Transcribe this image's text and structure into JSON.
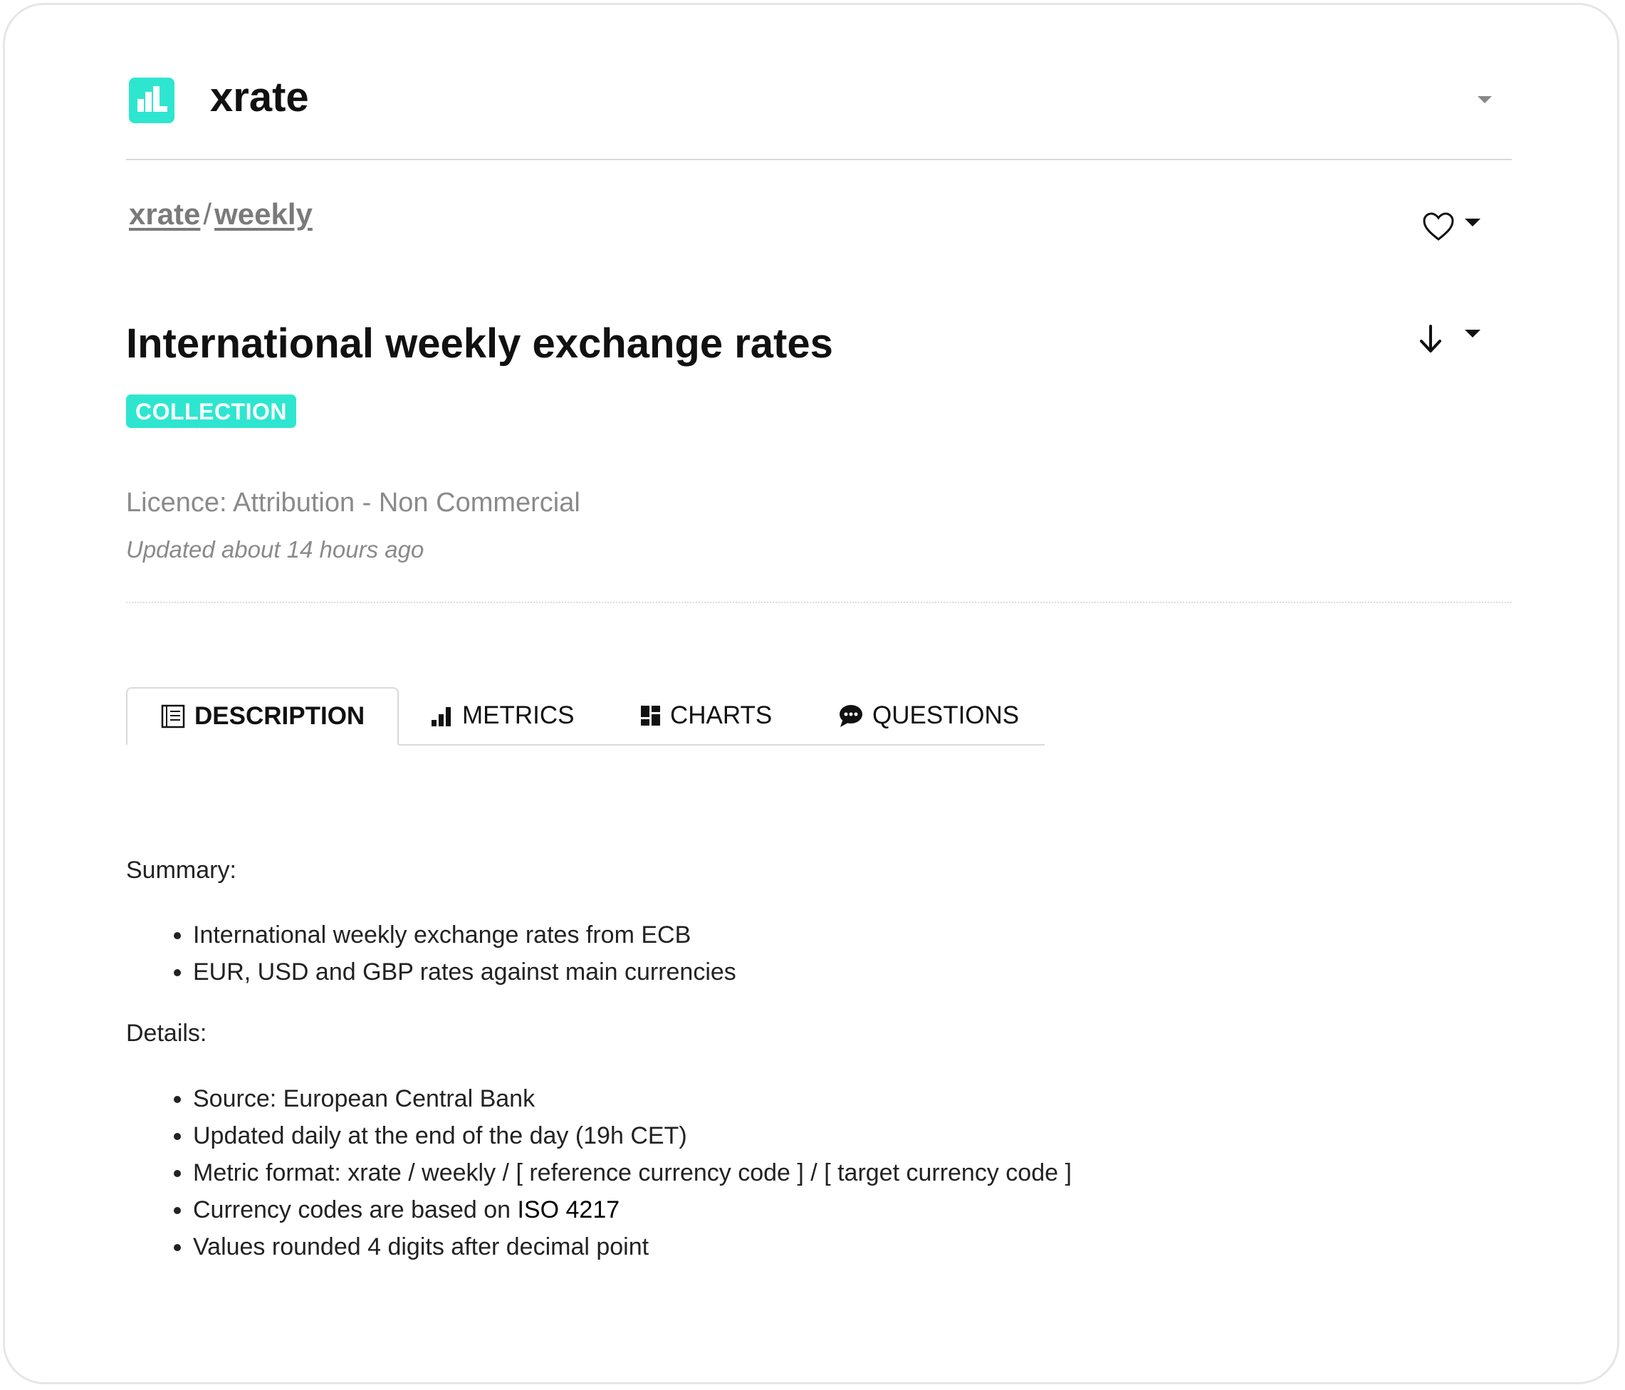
{
  "header": {
    "app_name": "xrate"
  },
  "breadcrumb": {
    "items": [
      "xrate",
      "weekly"
    ],
    "separator": "/"
  },
  "dataset": {
    "title": "International weekly exchange rates",
    "badge": "COLLECTION",
    "licence": "Licence: Attribution - Non Commercial",
    "updated": "Updated about 14 hours ago"
  },
  "tabs": [
    {
      "label": "DESCRIPTION",
      "icon": "document-icon",
      "active": true
    },
    {
      "label": "METRICS",
      "icon": "bar-chart-icon",
      "active": false
    },
    {
      "label": "CHARTS",
      "icon": "dashboard-icon",
      "active": false
    },
    {
      "label": "QUESTIONS",
      "icon": "chat-icon",
      "active": false
    }
  ],
  "description": {
    "summary_heading": "Summary:",
    "summary_items": [
      "International weekly exchange rates from ECB",
      "EUR, USD and GBP rates against main currencies"
    ],
    "details_heading": "Details:",
    "details_items": [
      "Source: European Central Bank",
      "Updated daily at the end of the day (19h CET)",
      "Metric format: xrate / weekly / [ reference currency code ] / [ target currency code ]",
      "Currency codes are based on ",
      "Values rounded 4 digits after decimal point"
    ],
    "iso_link": "ISO 4217"
  },
  "colors": {
    "accent": "#2ee6d0",
    "muted_text": "#8a8a8a",
    "border": "#d9d9d9"
  }
}
